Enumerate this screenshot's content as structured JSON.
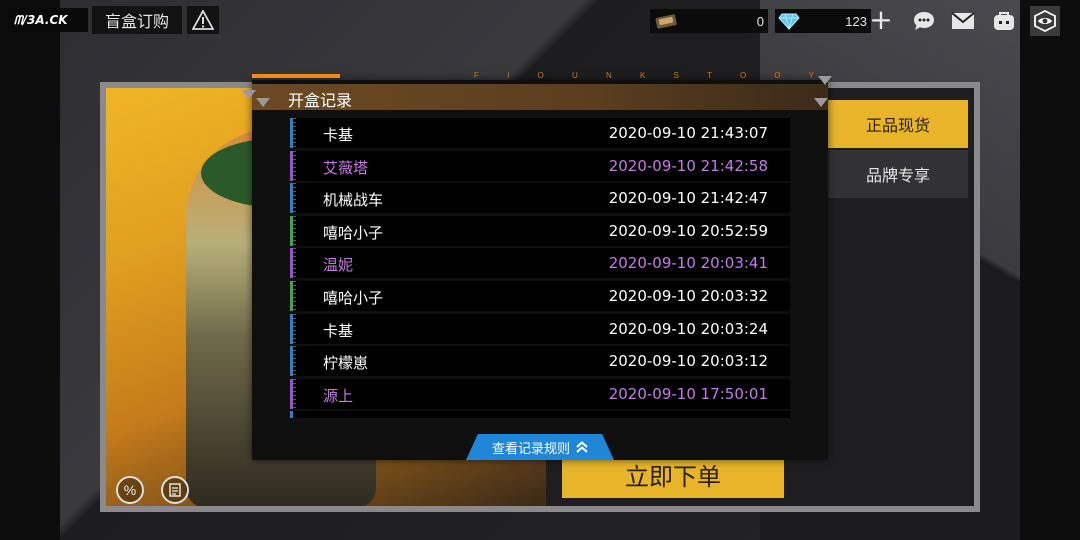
{
  "app": {
    "logo_text": "ᗰ/3A.CK",
    "tab_title": "盲盒订购"
  },
  "currencies": [
    {
      "icon": "coin-icon",
      "value": "0"
    },
    {
      "icon": "diamond-icon",
      "value": "123"
    }
  ],
  "top_icons": [
    "plus-icon",
    "chat-icon",
    "mail-icon",
    "backpack-icon",
    "eye-icon"
  ],
  "store": {
    "side_buttons": [
      "正品现货",
      "品牌专享"
    ],
    "order_label": "立即下单"
  },
  "dialog": {
    "deco_text": "F I O U N K S T O O Y",
    "title": "开盒记录",
    "rules_label": "查看记录规则",
    "records": [
      {
        "name": "卡基",
        "time": "2020-09-10 21:43:07",
        "rarity": "common"
      },
      {
        "name": "艾薇塔",
        "time": "2020-09-10 21:42:58",
        "rarity": "rare"
      },
      {
        "name": "机械战车",
        "time": "2020-09-10 21:42:47",
        "rarity": "common"
      },
      {
        "name": "嘻哈小子",
        "time": "2020-09-10 20:52:59",
        "rarity": "uncommon"
      },
      {
        "name": "温妮",
        "time": "2020-09-10 20:03:41",
        "rarity": "rare"
      },
      {
        "name": "嘻哈小子",
        "time": "2020-09-10 20:03:32",
        "rarity": "uncommon"
      },
      {
        "name": "卡基",
        "time": "2020-09-10 20:03:24",
        "rarity": "common"
      },
      {
        "name": "柠檬崽",
        "time": "2020-09-10 20:03:12",
        "rarity": "common"
      },
      {
        "name": "源上",
        "time": "2020-09-10 17:50:01",
        "rarity": "rare"
      }
    ]
  },
  "colors": {
    "common_bar": "#2a7fd6",
    "uncommon_bar": "#3aa84a",
    "rare_bar": "#9b4fd8",
    "rare_text": "#c77ae8",
    "common_text": "#ffffff",
    "accent_orange": "#f08a1c",
    "accent_yellow": "#e8b42a",
    "rules_blue": "#1f86d8"
  }
}
